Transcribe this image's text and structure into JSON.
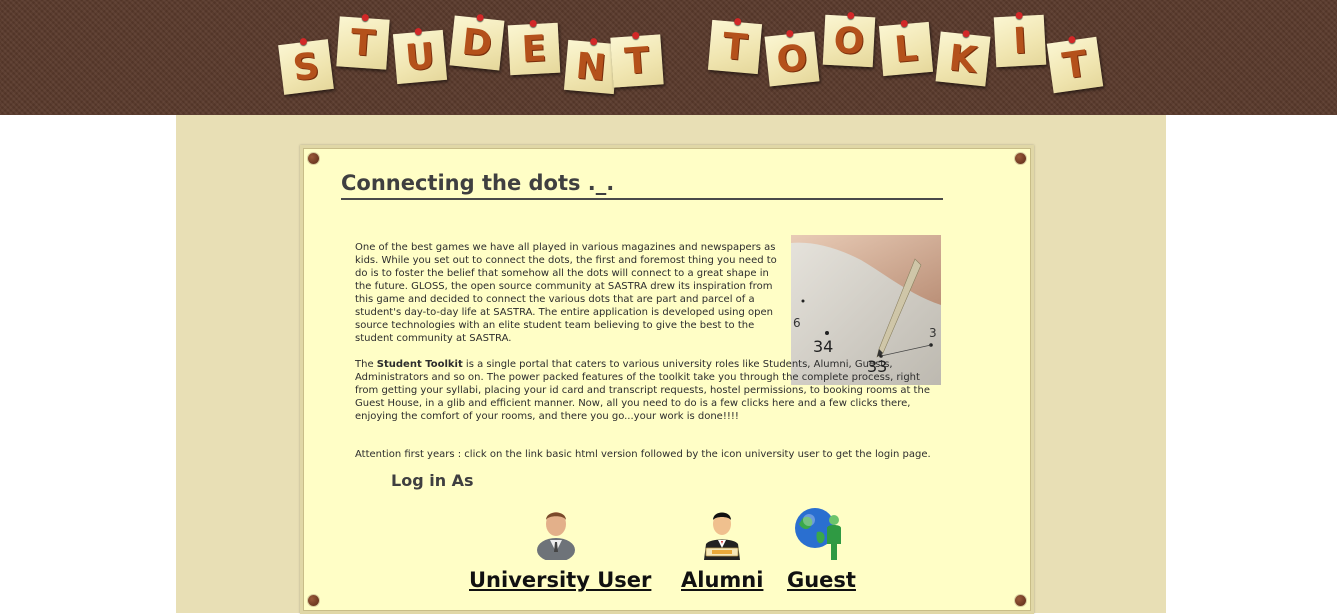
{
  "header": {
    "title_letters": [
      "S",
      "T",
      "U",
      "D",
      "E",
      "N",
      "T",
      "T",
      "O",
      "O",
      "L",
      "K",
      "I",
      "T"
    ],
    "title_alt": "STUDENT TOOLKIT"
  },
  "main": {
    "heading": "Connecting the dots ._.",
    "intro_paragraph_1": "One of the best games we have all played in various magazines and newspapers as kids. While you set out to connect the dots, the first and foremost thing you need to do is to foster the belief that somehow all the dots will connect to a great shape in the future. GLOSS, the open source community at SASTRA drew its inspiration from this game and decided to connect the various dots that are part and parcel of a student's day-to-day life at SASTRA. The entire application is developed using open source technologies with an elite student team believing to give the best to the student community at SASTRA.",
    "intro_paragraph_2_prefix": "The ",
    "intro_paragraph_2_bold": "Student Toolkit",
    "intro_paragraph_2_rest": " is a single portal that caters to various university roles like Students, Alumni, Guests, Administrators and so on. The power packed features of the toolkit take you through the complete process, right from getting your syllabi, placing your id card and transcript requests, hostel permissions, to booking rooms at the Guest House, in a glib and efficient manner. Now, all you need to do is a few clicks here and a few clicks there, enjoying the comfort of your rooms, and there you go...your work is done!!!!",
    "attention": "Attention first years : click on the link basic html version followed by the icon university user to get the login page.",
    "photo_numbers": [
      "34",
      "33",
      "6",
      "3"
    ],
    "login_title": "Log in As",
    "roles": [
      {
        "label": "University User",
        "icon": "university-user-icon"
      },
      {
        "label": "Alumni",
        "icon": "alumni-icon"
      },
      {
        "label": "Guest",
        "icon": "guest-globe-icon"
      }
    ]
  },
  "colors": {
    "header_bg": "#5a3a2c",
    "tile_letter": "#b4511b",
    "page_bg": "#e8dfb5",
    "card_bg": "#fffec6",
    "rivet": "#6b3420"
  }
}
